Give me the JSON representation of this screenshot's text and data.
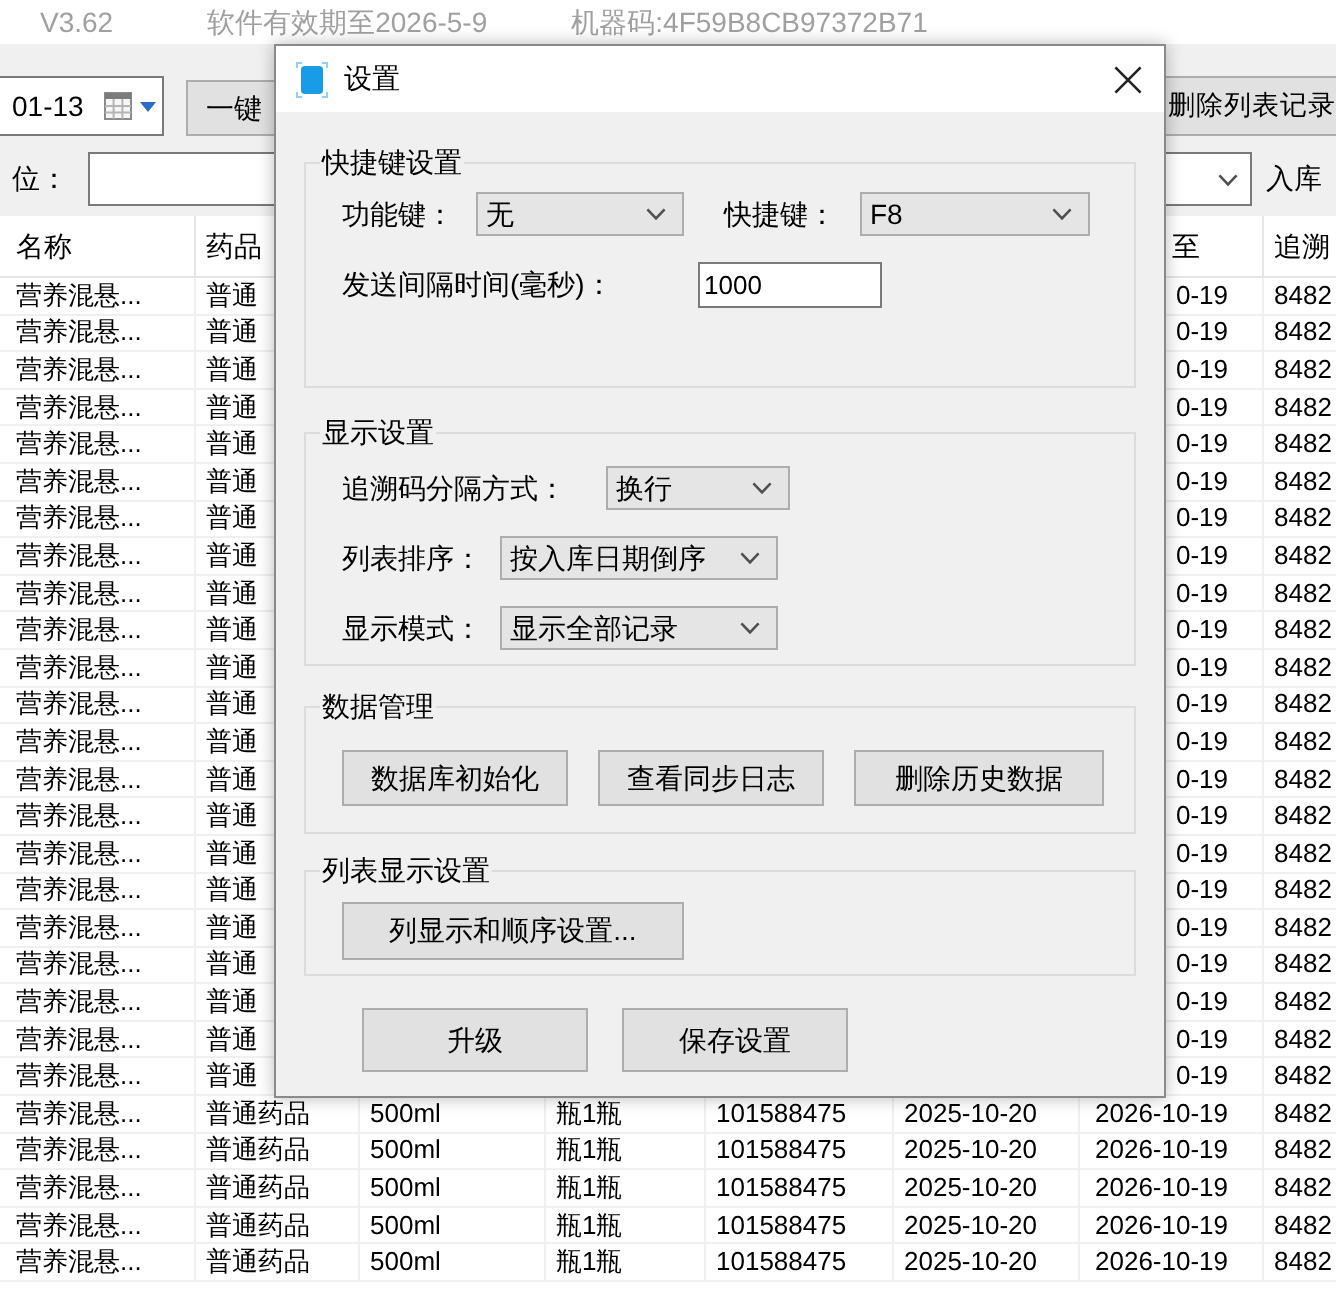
{
  "app": {
    "version": "V3.62",
    "license": "软件有效期至2026-5-9",
    "machine_code": "机器码:4F59B8CB97372B71"
  },
  "toolbar": {
    "date": "01-13",
    "left_button": "一键",
    "right_button": "删除列表记录"
  },
  "filter": {
    "label": "位：",
    "right_label": "入库"
  },
  "table": {
    "columns": [
      "名称",
      "药品",
      "至",
      "追溯"
    ],
    "rows": [
      {
        "kind": "covered",
        "cells": [
          "营养混悬...",
          "普通",
          "0-19",
          "8482"
        ]
      },
      {
        "kind": "covered",
        "cells": [
          "营养混悬...",
          "普通",
          "0-19",
          "8482"
        ]
      },
      {
        "kind": "covered",
        "cells": [
          "营养混悬...",
          "普通",
          "0-19",
          "8482"
        ]
      },
      {
        "kind": "covered",
        "cells": [
          "营养混悬...",
          "普通",
          "0-19",
          "8482"
        ]
      },
      {
        "kind": "covered",
        "cells": [
          "营养混悬...",
          "普通",
          "0-19",
          "8482"
        ]
      },
      {
        "kind": "covered",
        "cells": [
          "营养混悬...",
          "普通",
          "0-19",
          "8482"
        ]
      },
      {
        "kind": "covered",
        "cells": [
          "营养混悬...",
          "普通",
          "0-19",
          "8482"
        ]
      },
      {
        "kind": "covered",
        "cells": [
          "营养混悬...",
          "普通",
          "0-19",
          "8482"
        ]
      },
      {
        "kind": "covered",
        "cells": [
          "营养混悬...",
          "普通",
          "0-19",
          "8482"
        ]
      },
      {
        "kind": "covered",
        "cells": [
          "营养混悬...",
          "普通",
          "0-19",
          "8482"
        ]
      },
      {
        "kind": "covered",
        "cells": [
          "营养混悬...",
          "普通",
          "0-19",
          "8482"
        ]
      },
      {
        "kind": "covered",
        "cells": [
          "营养混悬...",
          "普通",
          "0-19",
          "8482"
        ]
      },
      {
        "kind": "covered",
        "cells": [
          "营养混悬...",
          "普通",
          "0-19",
          "8482"
        ]
      },
      {
        "kind": "covered",
        "cells": [
          "营养混悬...",
          "普通",
          "0-19",
          "8482"
        ]
      },
      {
        "kind": "covered",
        "cells": [
          "营养混悬...",
          "普通",
          "0-19",
          "8482"
        ]
      },
      {
        "kind": "covered",
        "cells": [
          "营养混悬...",
          "普通",
          "0-19",
          "8482"
        ]
      },
      {
        "kind": "covered",
        "cells": [
          "营养混悬...",
          "普通",
          "0-19",
          "8482"
        ]
      },
      {
        "kind": "covered",
        "cells": [
          "营养混悬...",
          "普通",
          "0-19",
          "8482"
        ]
      },
      {
        "kind": "covered",
        "cells": [
          "营养混悬...",
          "普通",
          "0-19",
          "8482"
        ]
      },
      {
        "kind": "covered",
        "cells": [
          "营养混悬...",
          "普通",
          "0-19",
          "8482"
        ]
      },
      {
        "kind": "covered",
        "cells": [
          "营养混悬...",
          "普通",
          "0-19",
          "8482"
        ]
      },
      {
        "kind": "covered",
        "cells": [
          "营养混悬...",
          "普通",
          "0-19",
          "8482"
        ]
      },
      {
        "kind": "full",
        "cells": [
          "营养混悬...",
          "普通药品",
          "500ml",
          "瓶1瓶",
          "101588475",
          "2025-10-20",
          "2026-10-19",
          "8482"
        ]
      },
      {
        "kind": "full",
        "cells": [
          "营养混悬...",
          "普通药品",
          "500ml",
          "瓶1瓶",
          "101588475",
          "2025-10-20",
          "2026-10-19",
          "8482"
        ]
      },
      {
        "kind": "full",
        "cells": [
          "营养混悬...",
          "普通药品",
          "500ml",
          "瓶1瓶",
          "101588475",
          "2025-10-20",
          "2026-10-19",
          "8482"
        ]
      },
      {
        "kind": "full",
        "cells": [
          "营养混悬...",
          "普通药品",
          "500ml",
          "瓶1瓶",
          "101588475",
          "2025-10-20",
          "2026-10-19",
          "8482"
        ]
      },
      {
        "kind": "full",
        "cells": [
          "营养混悬...",
          "普通药品",
          "500ml",
          "瓶1瓶",
          "101588475",
          "2025-10-20",
          "2026-10-19",
          "8482"
        ]
      }
    ]
  },
  "dialog": {
    "title": "设置",
    "groups": [
      {
        "title": "快捷键设置",
        "rows": [
          [
            {
              "kind": "select",
              "label": "功能键：",
              "value": "无"
            },
            {
              "kind": "select",
              "label": "快捷键：",
              "value": "F8"
            }
          ],
          [
            {
              "kind": "input",
              "label": "发送间隔时间(毫秒)：",
              "value": "1000"
            }
          ]
        ]
      },
      {
        "title": "显示设置",
        "rows": [
          [
            {
              "kind": "select",
              "label": "追溯码分隔方式：",
              "value": "换行"
            }
          ],
          [
            {
              "kind": "select",
              "label": "列表排序：",
              "value": "按入库日期倒序"
            }
          ],
          [
            {
              "kind": "select",
              "label": "显示模式：",
              "value": "显示全部记录"
            }
          ]
        ]
      },
      {
        "title": "数据管理",
        "buttons": [
          "数据库初始化",
          "查看同步日志",
          "删除历史数据"
        ]
      },
      {
        "title": "列表显示设置",
        "buttons": [
          "列显示和顺序设置..."
        ]
      }
    ],
    "buttons": [
      "升级",
      "保存设置"
    ]
  }
}
